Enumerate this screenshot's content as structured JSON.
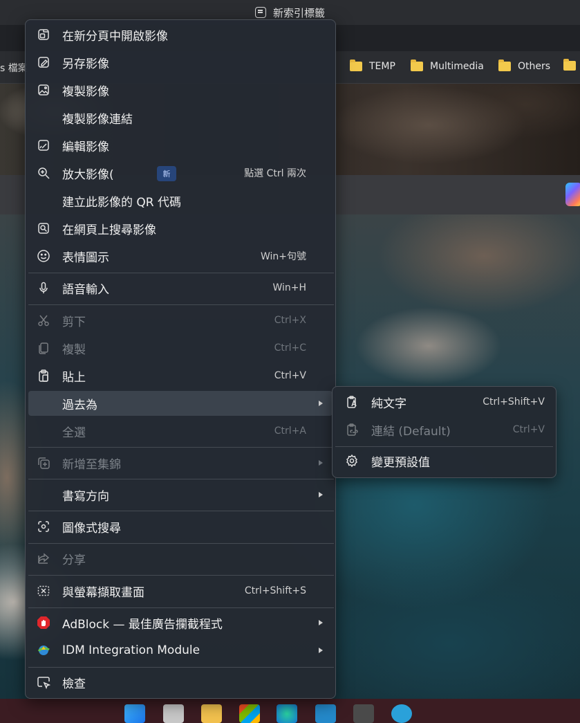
{
  "browser": {
    "tab_title": "新索引標籤",
    "bookmarks_left_fragment": "s 檔案",
    "bookmarks": [
      {
        "label": "TEMP",
        "icon": "folder-icon"
      },
      {
        "label": "Multimedia",
        "icon": "folder-icon"
      },
      {
        "label": "Others",
        "icon": "folder-icon"
      }
    ]
  },
  "context_menu": {
    "items": [
      {
        "label": "在新分頁中開啟影像",
        "icon": "open-image-new-tab-icon",
        "shortcut": "",
        "enabled": true
      },
      {
        "label": "另存影像",
        "icon": "save-image-icon",
        "shortcut": "",
        "enabled": true
      },
      {
        "label": "複製影像",
        "icon": "copy-image-icon",
        "shortcut": "",
        "enabled": true
      },
      {
        "label": "複製影像連結",
        "icon": "",
        "shortcut": "",
        "enabled": true
      },
      {
        "label": "編輯影像",
        "icon": "edit-image-icon",
        "shortcut": "",
        "enabled": true
      },
      {
        "label": "放大影像(",
        "icon": "zoom-in-icon",
        "badge": "新",
        "shortcut": "點選 Ctrl 兩次",
        "enabled": true
      },
      {
        "label": "建立此影像的 QR 代碼",
        "icon": "",
        "shortcut": "",
        "enabled": true
      },
      {
        "label": "在網頁上搜尋影像",
        "icon": "search-image-icon",
        "shortcut": "",
        "enabled": true
      },
      {
        "label": "表情圖示",
        "icon": "emoji-icon",
        "shortcut": "Win+句號",
        "enabled": true
      },
      {
        "label": "語音輸入",
        "icon": "microphone-icon",
        "shortcut": "Win+H",
        "enabled": true
      },
      {
        "label": "剪下",
        "icon": "scissors-icon",
        "shortcut": "Ctrl+X",
        "enabled": false
      },
      {
        "label": "複製",
        "icon": "copy-icon",
        "shortcut": "Ctrl+C",
        "enabled": false
      },
      {
        "label": "貼上",
        "icon": "paste-icon",
        "shortcut": "Ctrl+V",
        "enabled": true
      },
      {
        "label": "過去為",
        "icon": "",
        "shortcut": "",
        "enabled": true,
        "submenu": true,
        "highlighted": true
      },
      {
        "label": "全選",
        "icon": "",
        "shortcut": "Ctrl+A",
        "enabled": false
      },
      {
        "label": "新增至集錦",
        "icon": "collections-icon",
        "shortcut": "",
        "enabled": false,
        "submenu": true
      },
      {
        "label": "書寫方向",
        "icon": "",
        "shortcut": "",
        "enabled": true,
        "submenu": true
      },
      {
        "label": "圖像式搜尋",
        "icon": "visual-search-icon",
        "shortcut": "",
        "enabled": true
      },
      {
        "label": "分享",
        "icon": "share-icon",
        "shortcut": "",
        "enabled": false
      },
      {
        "label": "與螢幕擷取畫面",
        "icon": "screenshot-icon",
        "shortcut": "Ctrl+Shift+S",
        "enabled": true
      },
      {
        "label": "AdBlock — 最佳廣告攔截程式",
        "icon": "adblock-icon",
        "shortcut": "",
        "enabled": true,
        "submenu": true
      },
      {
        "label": "IDM Integration Module",
        "icon": "idm-icon",
        "shortcut": "",
        "enabled": true,
        "submenu": true
      },
      {
        "label": "檢查",
        "icon": "inspect-icon",
        "shortcut": "",
        "enabled": true
      }
    ]
  },
  "paste_as_submenu": {
    "items": [
      {
        "label": "純文字",
        "icon": "plain-text-paste-icon",
        "shortcut": "Ctrl+Shift+V",
        "enabled": true
      },
      {
        "label": "連結 (Default)",
        "icon": "link-paste-icon",
        "shortcut": "Ctrl+V",
        "enabled": false
      },
      {
        "label": "變更預設值",
        "icon": "settings-icon",
        "shortcut": "",
        "enabled": true
      }
    ]
  },
  "colors": {
    "menu_bg": "#242a32",
    "hover_bg": "#3b434d",
    "badge_bg": "#27457a",
    "taskbar": "#3b1c22"
  }
}
